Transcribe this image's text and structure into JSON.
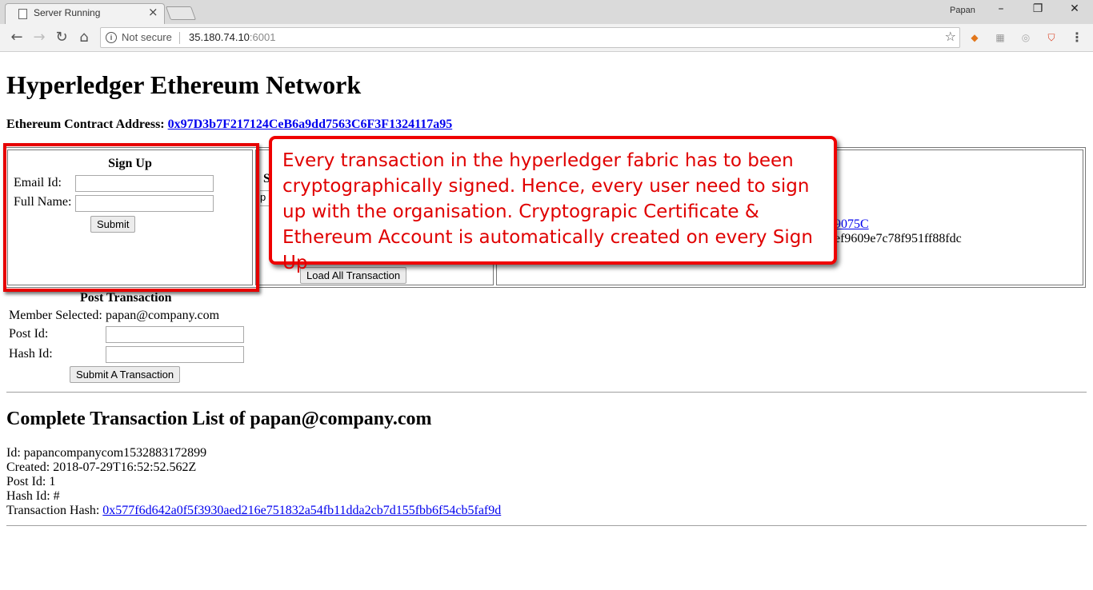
{
  "browser": {
    "tab_title": "Server Running",
    "profile_name": "Papan",
    "security_label": "Not secure",
    "url_host": "35.180.74.10",
    "url_port": ":6001",
    "icons": [
      "back-icon",
      "forward-icon",
      "reload-icon",
      "home-icon",
      "star-icon",
      "menu-icon"
    ]
  },
  "page": {
    "heading": "Hyperledger Ethereum Network",
    "contract_label": "Ethereum Contract Address:",
    "contract_address": "0x97D3b7F217124CeB6a9dd7563C6F3F1324117a95"
  },
  "signup": {
    "title": "Sign Up",
    "email_label": "Email Id:",
    "email_value": "",
    "name_label": "Full Name:",
    "name_value": "",
    "submit_label": "Submit"
  },
  "middle": {
    "partial_heading": "Se",
    "partial_select": "p",
    "load_all_label": "Load All Transaction"
  },
  "right": {
    "address_fragment": "9075C",
    "hash_fragment": "ef9609e7c78f951ff88fdc"
  },
  "post": {
    "title": "Post Transaction",
    "member_label": "Member Selected:",
    "member_value": "papan@company.com",
    "post_id_label": "Post Id:",
    "post_id_value": "",
    "hash_id_label": "Hash Id:",
    "hash_id_value": "",
    "submit_label": "Submit A Transaction"
  },
  "transactions": {
    "title": "Complete Transaction List of papan@company.com",
    "items": [
      {
        "id_line": "Id: papancompanycom1532883172899",
        "created_line": "Created: 2018-07-29T16:52:52.562Z",
        "post_line": "Post Id: 1",
        "hash_line": "Hash Id: #",
        "tx_hash_label": "Transaction Hash: ",
        "tx_hash": "0x577f6d642a0f5f3930aed216e751832a54fb11dda2cb7d155fbb6f54cb5faf9d"
      }
    ]
  },
  "annotation": {
    "callout_text": "Every transaction in the hyperledger fabric has to been cryptographically signed. Hence, every user need to sign up with the organisation. Cryptograpic Certificate & Ethereum Account is automatically created on every Sign Up",
    "accent_color": "#e60000"
  }
}
